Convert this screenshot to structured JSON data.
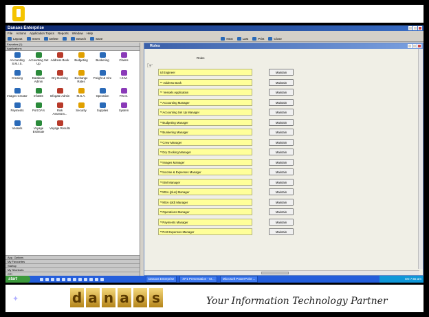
{
  "app": {
    "title": "Danaos Enterprise",
    "menu": [
      "File",
      "Actions",
      "Application Topics",
      "Reports",
      "Window",
      "Help"
    ],
    "toolbar": [
      "Layout",
      "Insert",
      "Delete",
      "",
      "Search",
      "Save",
      "",
      "",
      "",
      "Next",
      "Last",
      "Print",
      "Close"
    ]
  },
  "left_pane": {
    "top_headers": [
      "Favorites (1)",
      "Applications"
    ],
    "applications": [
      "Accounting S.M.I.S.",
      "Accounting Set Up",
      "Address Book",
      "Budgeting",
      "Bunkering",
      "Claims",
      "Crewing",
      "Database Admin",
      "Dry Docking",
      "Exchange Rates",
      "Freight & Hire",
      "I.S.M.",
      "Images Creator",
      "InfoBIS",
      "Infogate Admin",
      "M.S.A.",
      "Operation",
      "P.M.S.",
      "Payments",
      "Port DA's",
      "Risk Assessm...",
      "Security",
      "Supplies",
      "System",
      "Vessels",
      "Voyage Estimate",
      "Voyage Results"
    ],
    "bottom_headers": [
      "App. Options",
      "My Favourites",
      "Startup",
      "My Shortcuts",
      "GTI"
    ]
  },
  "roles_window": {
    "title": "Roles",
    "column_header": "Roles",
    "button_label": "Maintain",
    "roles": [
      "Id Engineer",
      "** Address Book",
      "** Vessels Application",
      "**Accounting Manager",
      "**Accounting Set Up Manager",
      "**Budgeting Manager",
      "**Bunkering Manager",
      "**Crew Manager",
      "**Dry Docking Manager",
      "**Images Manager",
      "**Income & Expenses Manager",
      "**ISM Manager",
      "**MSA (plus) Manager",
      "**MSA (old) Manager",
      "**Operations Manager",
      "**Payments Manager",
      "**Port Expenses Manager"
    ]
  },
  "taskbar": {
    "start": "start",
    "tasks": [
      "Danaos Enterprise",
      "XP1 Presentation - M...",
      "Microsoft PowerPoint ..."
    ],
    "tray": "EN 7:55 am"
  },
  "footer": {
    "logo_letters": [
      "d",
      "a",
      "n",
      "a",
      "o",
      "s"
    ],
    "tagline": "Your Information Technology Partner"
  },
  "colors": {
    "titlebar": "#0a246a",
    "role_field": "#ffff99",
    "taskbar": "#245edb",
    "logo_gold": "#d4a43a"
  }
}
